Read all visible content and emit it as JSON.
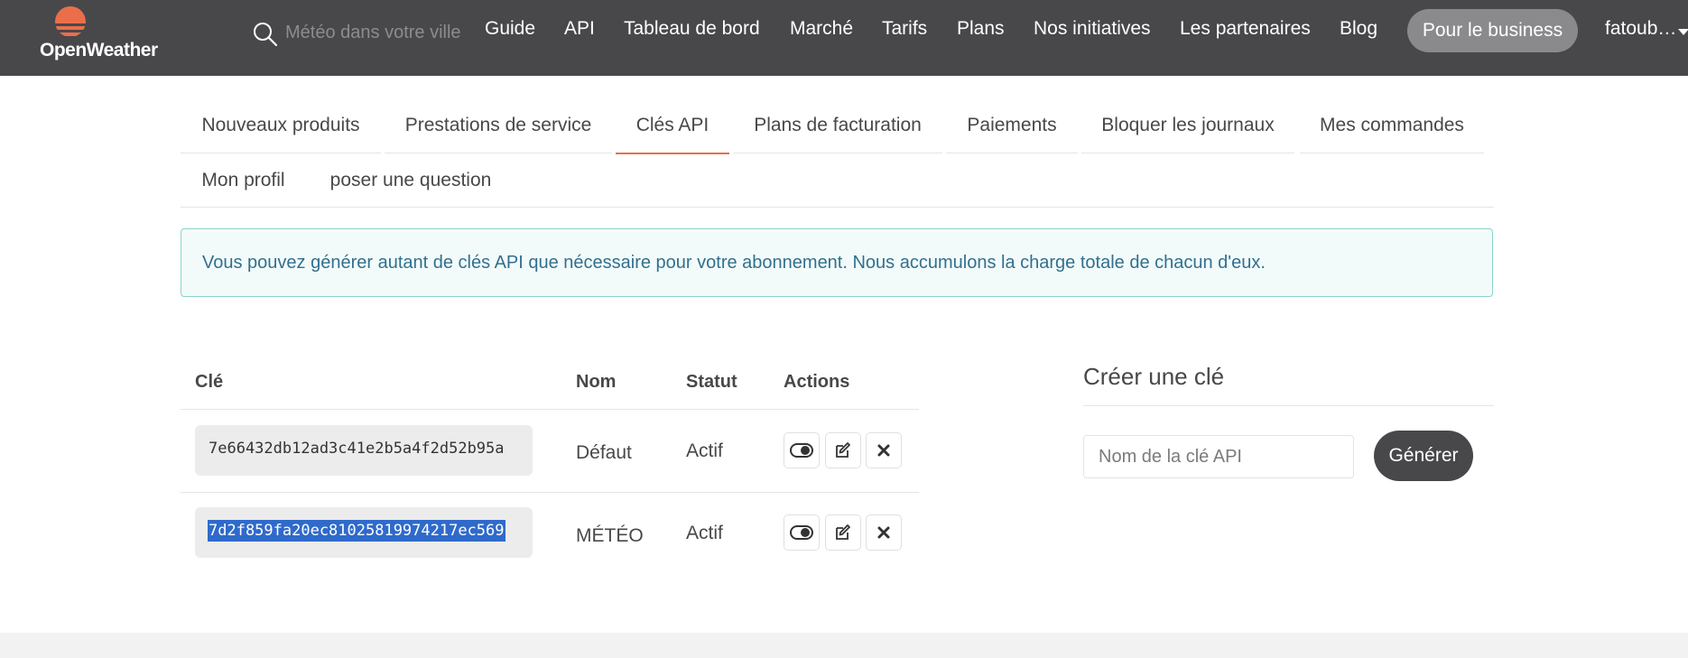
{
  "header": {
    "logo_text": "OpenWeather",
    "search_placeholder": "Météo dans votre ville",
    "nav": [
      "Guide",
      "API",
      "Tableau de bord",
      "Marché",
      "Tarifs",
      "Plans",
      "Nos initiatives",
      "Les partenaires",
      "Blog"
    ],
    "business_button": "Pour le business",
    "user": "fatoub…",
    "accent_color": "#eb6e4b",
    "bar_color": "#48484a"
  },
  "tabs": [
    "Nouveaux produits",
    "Prestations de service",
    "Clés API",
    "Plans de facturation",
    "Paiements",
    "Bloquer les journaux",
    "Mes commandes",
    "Mon profil",
    "poser une question"
  ],
  "active_tab": "Clés API",
  "alert": {
    "text": "Vous pouvez générer autant de clés API que nécessaire pour votre abonnement. Nous accumulons la charge totale de chacun d'eux."
  },
  "keys_table": {
    "columns": [
      "Clé",
      "Nom",
      "Statut",
      "Actions"
    ],
    "rows": [
      {
        "key": "7e66432db12ad3c41e2b5a4f2d52b95a",
        "name": "Défaut",
        "status": "Actif",
        "selected": false
      },
      {
        "key": "7d2f859fa20ec81025819974217ec569",
        "name": "MÉTÉO",
        "status": "Actif",
        "selected": true
      }
    ],
    "action_icons": [
      "toggle-icon",
      "edit-icon",
      "delete-icon"
    ]
  },
  "create_key": {
    "title": "Créer une clé",
    "input_placeholder": "Nom de la clé API",
    "button": "Générer"
  }
}
